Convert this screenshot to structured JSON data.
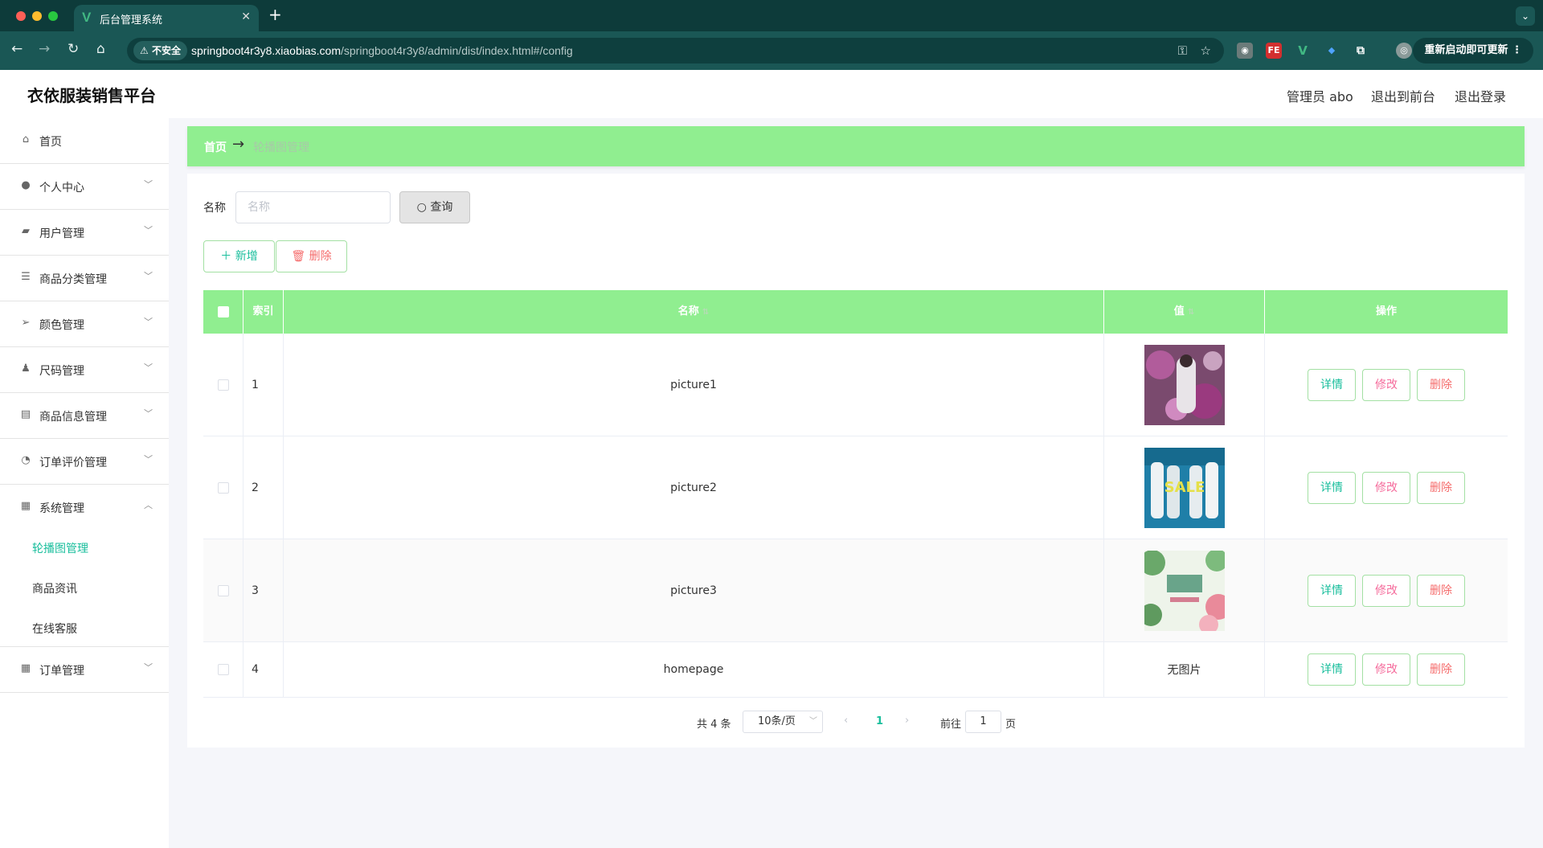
{
  "browser": {
    "tab_title": "后台管理系统",
    "tab_icon": "V",
    "insecure_label": "不安全",
    "url_host": "springboot4r3y8.xiaobias.com",
    "url_path": "/springboot4r3y8/admin/dist/index.html#/config",
    "update_label": "重新启动即可更新"
  },
  "header": {
    "brand": "衣依服装销售平台",
    "user": "管理员 abo",
    "to_front": "退出到前台",
    "logout": "退出登录"
  },
  "sidebar": {
    "items": [
      {
        "label": "首页",
        "icon": "home-icon"
      },
      {
        "label": "个人中心",
        "icon": "user-icon"
      },
      {
        "label": "用户管理",
        "icon": "users-icon"
      },
      {
        "label": "商品分类管理",
        "icon": "list-icon"
      },
      {
        "label": "颜色管理",
        "icon": "send-icon"
      },
      {
        "label": "尺码管理",
        "icon": "person-icon"
      },
      {
        "label": "商品信息管理",
        "icon": "message-icon"
      },
      {
        "label": "订单评价管理",
        "icon": "gauge-icon"
      },
      {
        "label": "系统管理",
        "icon": "document-icon"
      },
      {
        "label": "订单管理",
        "icon": "grid-icon"
      }
    ],
    "sub_items": [
      "轮播图管理",
      "商品资讯",
      "在线客服"
    ]
  },
  "breadcrumb": {
    "home": "首页",
    "current": "轮播图管理"
  },
  "search": {
    "label": "名称",
    "placeholder": "名称",
    "query_label": "查询"
  },
  "actions": {
    "add_label": "新增",
    "delete_label": "删除"
  },
  "table": {
    "headers": {
      "index": "索引",
      "name": "名称",
      "value": "值",
      "ops": "操作"
    },
    "rows": [
      {
        "index": "1",
        "name": "picture1",
        "value": ""
      },
      {
        "index": "2",
        "name": "picture2",
        "value": ""
      },
      {
        "index": "3",
        "name": "picture3",
        "value": ""
      },
      {
        "index": "4",
        "name": "homepage",
        "value": "无图片"
      }
    ],
    "op_labels": {
      "detail": "详情",
      "edit": "修改",
      "delete": "删除"
    }
  },
  "pagination": {
    "total": "共 4 条",
    "page_size": "10条/页",
    "current_page": "1",
    "goto_label": "前往",
    "goto_value": "1",
    "page_suffix": "页"
  },
  "colors": {
    "accent_green": "#90ee90",
    "primary": "#19be9c",
    "danger": "#f56c6c"
  }
}
